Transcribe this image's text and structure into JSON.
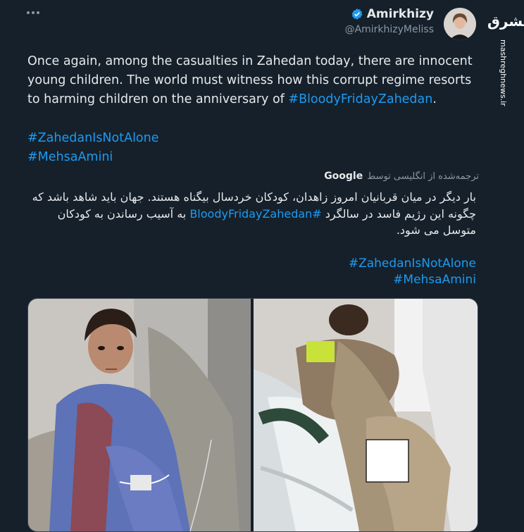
{
  "author": {
    "display_name": "Amirkhizy",
    "handle": "@AmirkhizyMeliss"
  },
  "watermark": {
    "logo_text": "مشرق",
    "site": "mashreghnews.ir"
  },
  "tweet": {
    "text_before": "Once again, among the casualties in Zahedan today, there are innocent young children. The world must witness how this corrupt regime resorts to harming children on the anniversary of ",
    "hashtag_inline": "#BloodyFridayZahedan",
    "text_after": ".",
    "hashtags": [
      "#ZahedanIsNotAlone",
      "#MehsaAmini"
    ]
  },
  "translation": {
    "label": "ترجمه‌شده از انگلیسی توسط",
    "provider": "Google",
    "text_before": "بار دیگر در میان قربانیان امروز زاهدان، کودکان خردسال بیگناه هستند. جهان باید شاهد باشد که چگونه این رژیم فاسد در سالگرد ",
    "hashtag_inline": "#BloodyFridayZahedan",
    "text_after": " به آسیب رساندن به کودکان متوسل می شود.",
    "hashtags": [
      "#ZahedanIsNotAlone",
      "#MehsaAmini"
    ]
  },
  "media": {
    "left_photo": "boy-on-hospital-chair",
    "right_photo": "child-on-stretcher"
  },
  "colors": {
    "background": "#15202b",
    "link": "#1d9bf0",
    "verified": "#1d9bf0",
    "secondary_text": "#8b98a5"
  }
}
